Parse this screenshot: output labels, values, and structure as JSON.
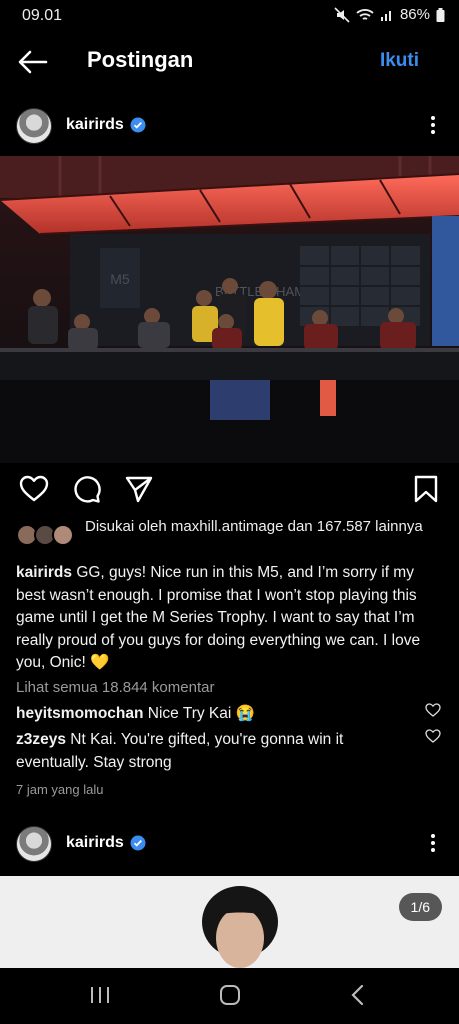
{
  "status": {
    "time": "09.01",
    "battery": "86%"
  },
  "header": {
    "title": "Postingan",
    "follow": "Ikuti"
  },
  "post": {
    "username": "kairirds",
    "likes_text": "Disukai oleh maxhill.antimage dan 167.587 lainnya",
    "caption_user": "kairirds",
    "caption_text": " GG, guys! Nice run in this M5, and I’m sorry if my best wasn’t enough. I promise that I won’t stop playing this game until I get the M Series Trophy. I want to say that I’m really proud of you guys for doing everything we can. I love you, Onic! 💛",
    "view_comments": "Lihat semua 18.844 komentar",
    "comments": [
      {
        "user": "heyitsmomochan",
        "text": " Nice Try Kai 😭"
      },
      {
        "user": "z3zeys",
        "text": " Nt Kai. You're gifted, you're gonna win it eventually. Stay strong"
      }
    ],
    "time_ago": "7 jam yang lalu"
  },
  "post2": {
    "username": "kairirds",
    "counter": "1/6"
  },
  "colors": {
    "accent": "#3b8df0",
    "background": "#000000",
    "muted": "#9a9a9a"
  },
  "icons": [
    "back-arrow-icon",
    "verified-icon",
    "more-icon",
    "heart-icon",
    "comment-icon",
    "share-icon",
    "bookmark-icon",
    "recents-icon",
    "home-icon",
    "back-icon"
  ]
}
